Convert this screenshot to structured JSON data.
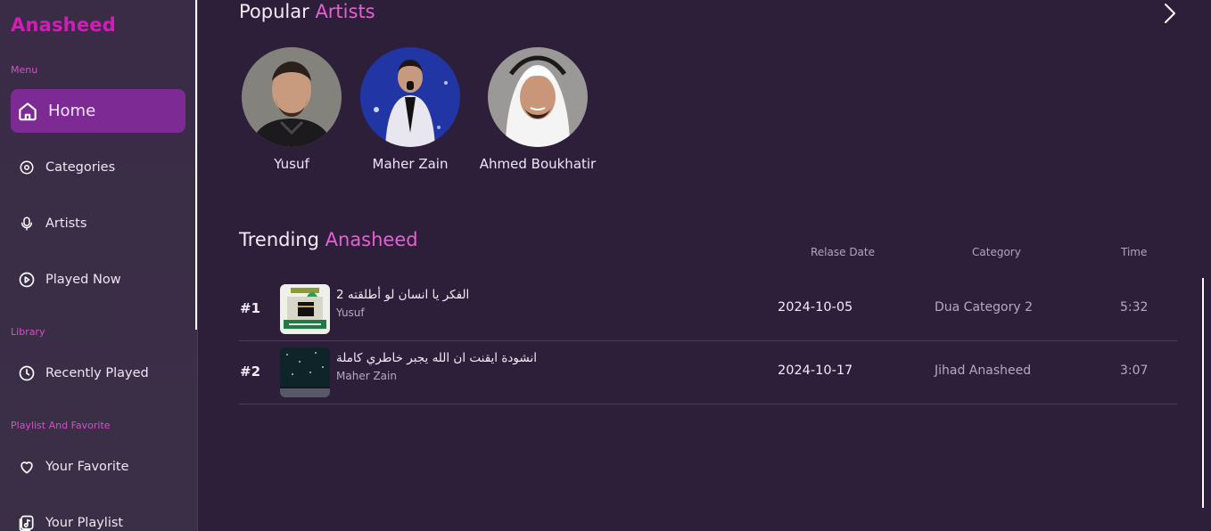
{
  "app": {
    "logo": "Anasheed"
  },
  "sidebar": {
    "menu_label": "Menu",
    "library_label": "Library",
    "playlist_label": "Playlist And Favorite",
    "items": [
      {
        "label": "Home",
        "icon": "home-icon"
      },
      {
        "label": "Categories",
        "icon": "disc-icon"
      },
      {
        "label": "Artists",
        "icon": "microphone-icon"
      },
      {
        "label": "Played Now",
        "icon": "play-circle-icon"
      },
      {
        "label": "Recently Played",
        "icon": "clock-icon"
      },
      {
        "label": "Your Favorite",
        "icon": "heart-icon"
      },
      {
        "label": "Your Playlist",
        "icon": "playlist-icon"
      }
    ]
  },
  "popular": {
    "title_a": "Popular",
    "title_b": "Artists",
    "artists": [
      {
        "name": "Yusuf"
      },
      {
        "name": "Maher Zain"
      },
      {
        "name": "Ahmed Boukhatir"
      }
    ]
  },
  "trending": {
    "title_a": "Trending",
    "title_b": "Anasheed",
    "columns": {
      "date": "Relase Date",
      "category": "Category",
      "time": "Time"
    },
    "rows": [
      {
        "rank": "#1",
        "title": "الفكر يا انسان لو أطلقته 2",
        "artist": "Yusuf",
        "date": "2024-10-05",
        "category": "Dua Category 2",
        "time": "5:32"
      },
      {
        "rank": "#2",
        "title": "انشودة ايقنت ان الله يجبر خاطري كاملة",
        "artist": "Maher Zain",
        "date": "2024-10-17",
        "category": "Jihad Anasheed",
        "time": "3:07"
      }
    ]
  },
  "colors": {
    "accent": "#e85fd3",
    "logo": "#d31cb6",
    "active_nav": "#7d2a95",
    "background": "#2d1f39"
  }
}
